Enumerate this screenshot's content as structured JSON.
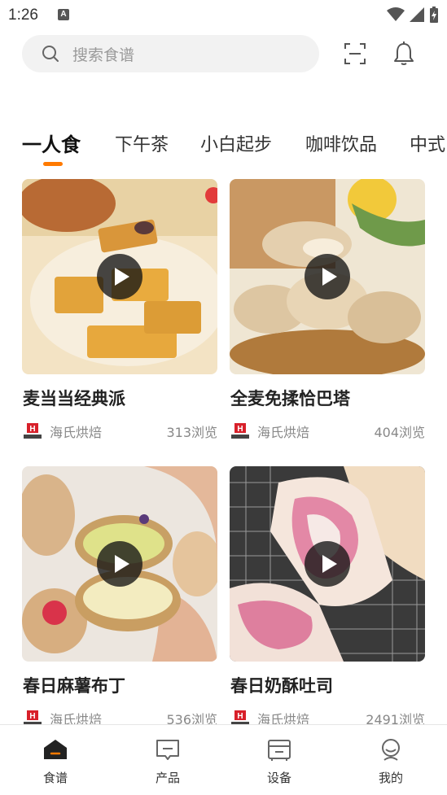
{
  "status_bar": {
    "time": "1:26",
    "notification_badge": "A"
  },
  "search": {
    "placeholder": "搜索食谱"
  },
  "tabs": [
    {
      "label": "一人食",
      "active": true
    },
    {
      "label": "下午茶",
      "active": false
    },
    {
      "label": "小白起步",
      "active": false
    },
    {
      "label": "咖啡饮品",
      "active": false
    },
    {
      "label": "中式",
      "active": false
    }
  ],
  "cards": [
    {
      "title": "麦当当经典派",
      "brand": "海氏烘焙",
      "views": "313浏览",
      "image": "golden-pastries-photo"
    },
    {
      "title": "全麦免揉恰巴塔",
      "brand": "海氏烘焙",
      "views": "404浏览",
      "image": "ciabatta-bread-photo"
    },
    {
      "title": "春日麻薯布丁",
      "brand": "海氏烘焙",
      "views": "536浏览",
      "image": "mochi-pudding-photo"
    },
    {
      "title": "春日奶酥吐司",
      "brand": "海氏烘焙",
      "views": "2491浏览",
      "image": "pink-swirl-toast-photo"
    }
  ],
  "bottom_nav": [
    {
      "label": "食谱",
      "icon": "home-icon",
      "active": true
    },
    {
      "label": "产品",
      "icon": "product-icon",
      "active": false
    },
    {
      "label": "设备",
      "icon": "device-icon",
      "active": false
    },
    {
      "label": "我的",
      "icon": "profile-icon",
      "active": false
    }
  ],
  "colors": {
    "accent": "#ff7a00",
    "search_bg": "#f2f2f2",
    "text_muted": "#888888"
  }
}
